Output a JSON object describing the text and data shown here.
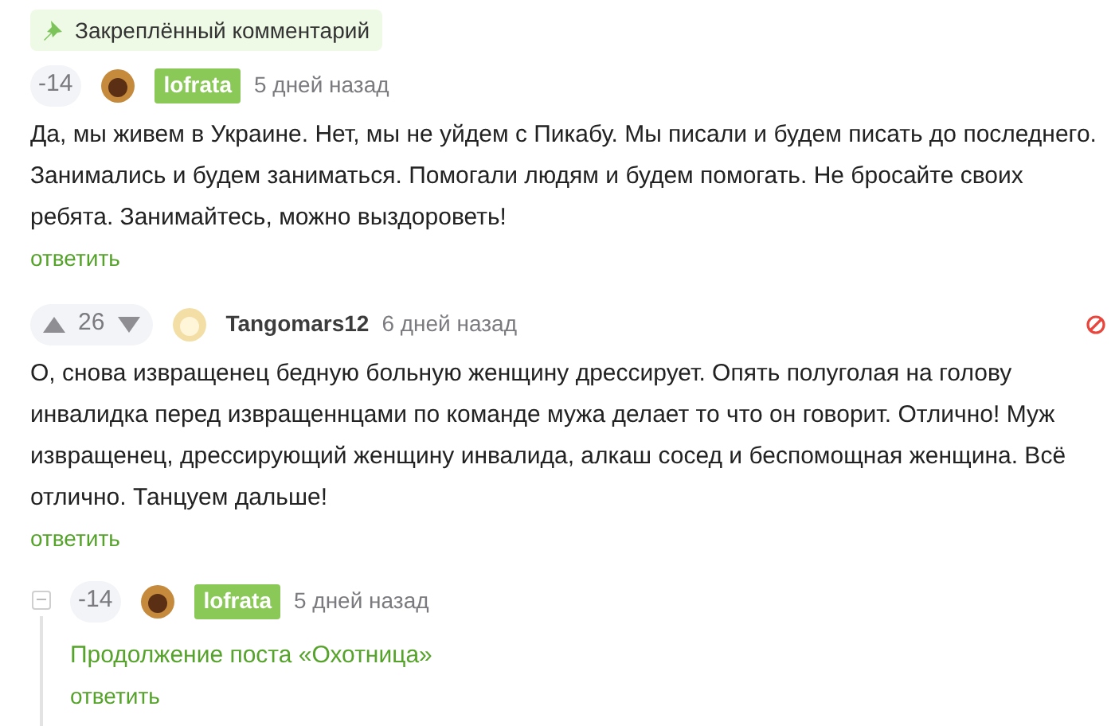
{
  "pinned_label": "Закреплённый комментарий",
  "comments": [
    {
      "rating": "-14",
      "vote_arrows": false,
      "author": "lofrata",
      "author_badge": true,
      "time": "5 дней назад",
      "text": "Да, мы живем в Украине. Нет, мы не уйдем с Пикабу. Мы писали и будем писать до последнего. Занимались и будем заниматься. Помогали людям и будем помогать. Не бросайте своих ребята. Занимайтесь, можно выздороветь!",
      "reply": "ответить",
      "block_icon": false,
      "collapse": false
    },
    {
      "rating": "26",
      "vote_arrows": true,
      "author": "Tangomars12",
      "author_badge": false,
      "time": "6 дней назад",
      "text": "О, снова извращенец бедную больную женщину дрессирует. Опять полуголая на голову инвалидка перед извращеннцами по команде мужа делает то что он говорит. Отлично! Муж извращенец, дрессирующий женщину инвалида, алкаш сосед и беспомощная женщина. Всё отлично. Танцуем дальше!",
      "reply": "ответить",
      "block_icon": true,
      "collapse": false
    },
    {
      "rating": "-14",
      "vote_arrows": false,
      "author": "lofrata",
      "author_badge": true,
      "time": "5 дней назад",
      "link_text": "Продолжение поста «Охотница»",
      "reply": "ответить",
      "block_icon": false,
      "collapse": true
    }
  ]
}
